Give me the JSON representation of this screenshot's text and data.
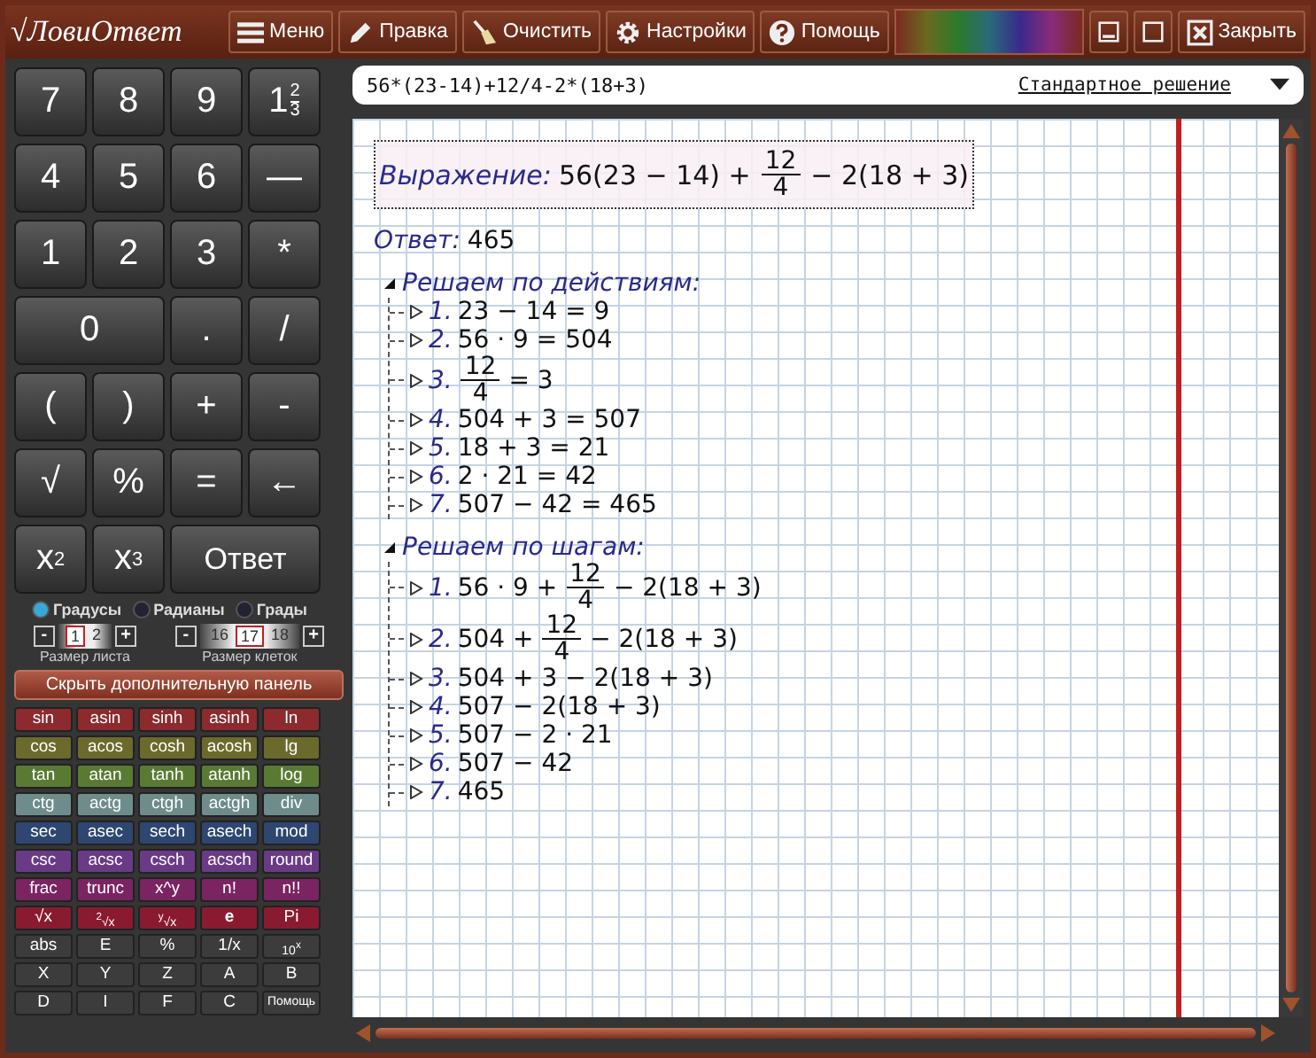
{
  "app": {
    "logo_sign": "√",
    "logo": "ЛовиОтвет"
  },
  "toolbar": [
    {
      "kind": "menu",
      "label": "Меню"
    },
    {
      "kind": "edit",
      "label": "Правка"
    },
    {
      "kind": "clear",
      "label": "Очистить"
    },
    {
      "kind": "settings",
      "label": "Настройки"
    },
    {
      "kind": "help",
      "label": "Помощь"
    }
  ],
  "window_controls": {
    "close_label": "Закрыть"
  },
  "keypad": [
    [
      {
        "kind": "text",
        "label": "7"
      },
      {
        "kind": "text",
        "label": "8"
      },
      {
        "kind": "text",
        "label": "9"
      },
      {
        "kind": "mixed",
        "whole": "1",
        "num": "2",
        "den": "3"
      }
    ],
    [
      {
        "kind": "text",
        "label": "4"
      },
      {
        "kind": "text",
        "label": "5"
      },
      {
        "kind": "text",
        "label": "6"
      },
      {
        "kind": "text",
        "label": "—"
      }
    ],
    [
      {
        "kind": "text",
        "label": "1"
      },
      {
        "kind": "text",
        "label": "2"
      },
      {
        "kind": "text",
        "label": "3"
      },
      {
        "kind": "text",
        "label": "*"
      }
    ],
    [
      {
        "kind": "text",
        "label": "0",
        "wide": true
      },
      {
        "kind": "text",
        "label": "."
      },
      {
        "kind": "text",
        "label": "/"
      }
    ],
    [
      {
        "kind": "text",
        "label": "("
      },
      {
        "kind": "text",
        "label": ")"
      },
      {
        "kind": "text",
        "label": "+"
      },
      {
        "kind": "text",
        "label": "-"
      }
    ],
    [
      {
        "kind": "text",
        "label": "√"
      },
      {
        "kind": "text",
        "label": "%"
      },
      {
        "kind": "text",
        "label": "="
      },
      {
        "kind": "text",
        "label": "←"
      }
    ],
    [
      {
        "kind": "power",
        "base": "x",
        "exp": "2"
      },
      {
        "kind": "power",
        "base": "x",
        "exp": "3"
      },
      {
        "kind": "text",
        "label": "Ответ",
        "wide": true
      }
    ]
  ],
  "angle_units": [
    {
      "label": "Градусы",
      "selected": true
    },
    {
      "label": "Радианы",
      "selected": false
    },
    {
      "label": "Грады",
      "selected": false
    }
  ],
  "spinners": [
    {
      "minus": "-",
      "plus": "+",
      "caption": "Размер листа",
      "values": [
        {
          "value": "1",
          "selected": true
        },
        {
          "value": "2",
          "selected": false
        }
      ]
    },
    {
      "minus": "-",
      "plus": "+",
      "caption": "Размер клеток",
      "values": [
        {
          "value": "16",
          "selected": false
        },
        {
          "value": "17",
          "selected": true
        },
        {
          "value": "18",
          "selected": false
        }
      ]
    }
  ],
  "toggle_panel_button": "Скрыть дополнительную панель",
  "function_rows": [
    {
      "color": "#8c2a2e",
      "keys": [
        "sin",
        "asin",
        "sinh",
        "asinh",
        "ln"
      ]
    },
    {
      "color": "#6b6a2c",
      "keys": [
        "cos",
        "acos",
        "cosh",
        "acosh",
        "lg"
      ]
    },
    {
      "color": "#5a7a34",
      "keys": [
        "tan",
        "atan",
        "tanh",
        "atanh",
        "log"
      ]
    },
    {
      "color": "#6e8c8c",
      "keys": [
        "ctg",
        "actg",
        "ctgh",
        "actgh",
        "div"
      ]
    },
    {
      "color": "#2e4670",
      "keys": [
        "sec",
        "asec",
        "sech",
        "asech",
        "mod"
      ]
    },
    {
      "color": "#6a3a86",
      "keys": [
        "csc",
        "acsc",
        "csch",
        "acsch",
        "round"
      ]
    },
    {
      "color": "#7a2462",
      "keys": [
        "frac",
        "trunc",
        "x^y",
        "n!",
        "n!!"
      ]
    },
    {
      "color": "#8a1a30",
      "keys": [
        "√x",
        "$^{2}$√x",
        "$^{y}$√x",
        "**e**",
        "Pi"
      ]
    },
    {
      "color": "#3c3c3c",
      "keys": [
        "abs",
        "E",
        "%",
        "1/x",
        "10$^{x}$"
      ]
    },
    {
      "color": "#3c3c3c",
      "keys": [
        "X",
        "Y",
        "Z",
        "A",
        "B"
      ]
    },
    {
      "color": "#3c3c3c",
      "keys": [
        "D",
        "I",
        "F",
        "C",
        "Помощь"
      ]
    }
  ],
  "expression_input": {
    "value": "56*(23-14)+12/4-2*(18+3)",
    "mode": "Стандартное решение"
  },
  "notebook": {
    "expression": {
      "label": "Выражение:",
      "parts": [
        {
          "kind": "text",
          "text": "56(23 − 14) +"
        },
        {
          "kind": "frac",
          "num": "12",
          "den": "4"
        },
        {
          "kind": "text",
          "text": "− 2(18 + 3)"
        }
      ]
    },
    "answer": {
      "label": "Ответ:",
      "value": "465"
    },
    "sections": [
      {
        "title": "Решаем по действиям:",
        "expanded": true,
        "steps": [
          {
            "number": "1.",
            "expanded": false,
            "parts": [
              {
                "kind": "text",
                "text": "23 − 14 = 9"
              }
            ]
          },
          {
            "number": "2.",
            "expanded": false,
            "parts": [
              {
                "kind": "text",
                "text": "56 · 9 = 504"
              }
            ]
          },
          {
            "number": "3.",
            "expanded": false,
            "parts": [
              {
                "kind": "frac",
                "num": "12",
                "den": "4"
              },
              {
                "kind": "text",
                "text": "= 3"
              }
            ]
          },
          {
            "number": "4.",
            "expanded": false,
            "parts": [
              {
                "kind": "text",
                "text": "504 + 3 = 507"
              }
            ]
          },
          {
            "number": "5.",
            "expanded": false,
            "parts": [
              {
                "kind": "text",
                "text": "18 + 3 = 21"
              }
            ]
          },
          {
            "number": "6.",
            "expanded": false,
            "parts": [
              {
                "kind": "text",
                "text": "2 · 21 = 42"
              }
            ]
          },
          {
            "number": "7.",
            "expanded": false,
            "parts": [
              {
                "kind": "text",
                "text": "507 − 42 = 465"
              }
            ]
          }
        ]
      },
      {
        "title": "Решаем по шагам:",
        "expanded": true,
        "steps": [
          {
            "number": "1.",
            "expanded": false,
            "parts": [
              {
                "kind": "text",
                "text": "56 · 9 +"
              },
              {
                "kind": "frac",
                "num": "12",
                "den": "4"
              },
              {
                "kind": "text",
                "text": "− 2(18 + 3)"
              }
            ]
          },
          {
            "number": "2.",
            "expanded": false,
            "parts": [
              {
                "kind": "text",
                "text": "504 +"
              },
              {
                "kind": "frac",
                "num": "12",
                "den": "4"
              },
              {
                "kind": "text",
                "text": "− 2(18 + 3)"
              }
            ]
          },
          {
            "number": "3.",
            "expanded": false,
            "parts": [
              {
                "kind": "text",
                "text": "504 + 3 − 2(18 + 3)"
              }
            ]
          },
          {
            "number": "4.",
            "expanded": false,
            "parts": [
              {
                "kind": "text",
                "text": "507 − 2(18 + 3)"
              }
            ]
          },
          {
            "number": "5.",
            "expanded": false,
            "parts": [
              {
                "kind": "text",
                "text": "507 − 2 · 21"
              }
            ]
          },
          {
            "number": "6.",
            "expanded": false,
            "parts": [
              {
                "kind": "text",
                "text": "507 − 42"
              }
            ]
          },
          {
            "number": "7.",
            "expanded": false,
            "parts": [
              {
                "kind": "text",
                "text": "465"
              }
            ]
          }
        ]
      }
    ]
  }
}
